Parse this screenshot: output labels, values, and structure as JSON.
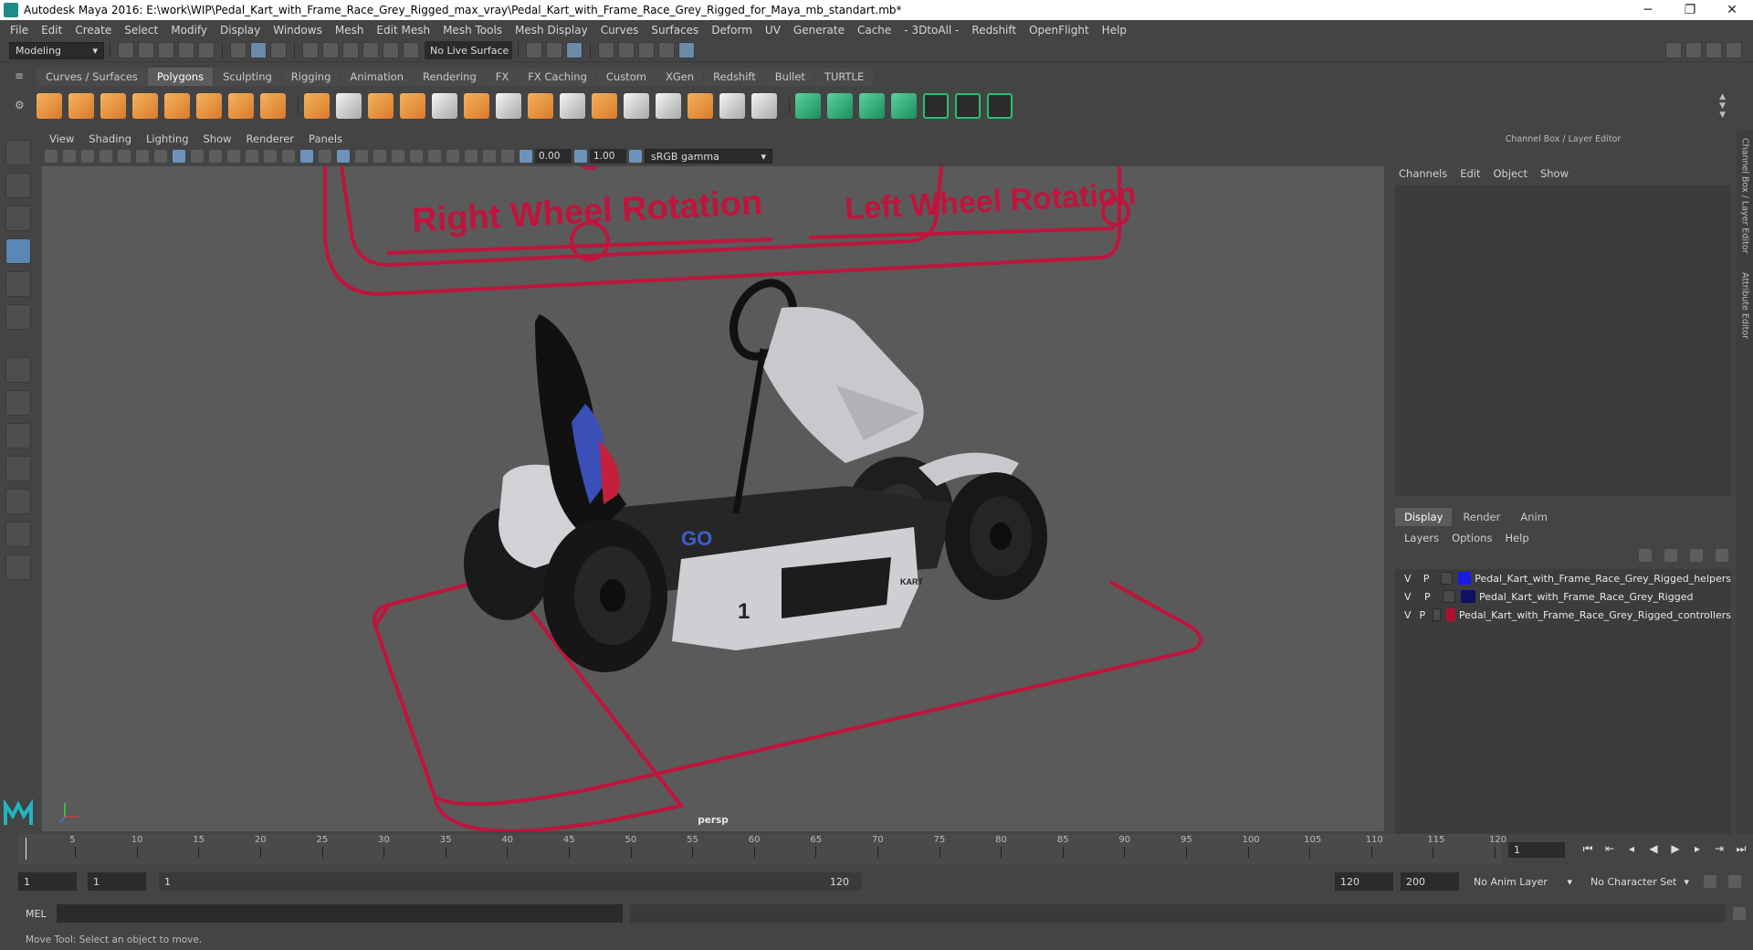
{
  "window": {
    "title": "Autodesk Maya 2016: E:\\work\\WIP\\Pedal_Kart_with_Frame_Race_Grey_Rigged_max_vray\\Pedal_Kart_with_Frame_Race_Grey_Rigged_for_Maya_mb_standart.mb*",
    "min_glyph": "─",
    "max_glyph": "❐",
    "close_glyph": "✕"
  },
  "menubar": [
    "File",
    "Edit",
    "Create",
    "Select",
    "Modify",
    "Display",
    "Windows",
    "Mesh",
    "Edit Mesh",
    "Mesh Tools",
    "Mesh Display",
    "Curves",
    "Surfaces",
    "Deform",
    "UV",
    "Generate",
    "Cache",
    "- 3DtoAll -",
    "Redshift",
    "OpenFlight",
    "Help"
  ],
  "statusline": {
    "mode": "Modeling",
    "live_surface": "No Live Surface"
  },
  "shelf": {
    "tabs": [
      "Curves / Surfaces",
      "Polygons",
      "Sculpting",
      "Rigging",
      "Animation",
      "Rendering",
      "FX",
      "FX Caching",
      "Custom",
      "XGen",
      "Redshift",
      "Bullet",
      "TURTLE"
    ],
    "active_tab": 1
  },
  "viewport": {
    "menu": [
      "View",
      "Shading",
      "Lighting",
      "Show",
      "Renderer",
      "Panels"
    ],
    "field_a": "0.00",
    "field_b": "1.00",
    "color_space": "sRGB gamma",
    "camera": "persp",
    "labels": {
      "right": "Right Wheel Rotation",
      "left": "Left Wheel Rotation",
      "go": "GO",
      "number": "1",
      "kart": "KART"
    },
    "colors": {
      "controller": "#c0143c",
      "kart_body": "#c9c9cd",
      "background": "#5a5a5a"
    }
  },
  "right_panel": {
    "title": "Channel Box / Layer Editor",
    "cb_menu": [
      "Channels",
      "Edit",
      "Object",
      "Show"
    ],
    "le_tabs": [
      "Display",
      "Render",
      "Anim"
    ],
    "le_active": 0,
    "le_menu": [
      "Layers",
      "Options",
      "Help"
    ],
    "layers": [
      {
        "v": "V",
        "p": "P",
        "color": "#1a1ae6",
        "name": "Pedal_Kart_with_Frame_Race_Grey_Rigged_helpers"
      },
      {
        "v": "V",
        "p": "P",
        "color": "#101060",
        "name": "Pedal_Kart_with_Frame_Race_Grey_Rigged"
      },
      {
        "v": "V",
        "p": "P",
        "color": "#b01030",
        "name": "Pedal_Kart_with_Frame_Race_Grey_Rigged_controllers"
      }
    ],
    "side_tabs": [
      "Channel Box / Layer Editor",
      "Attribute Editor"
    ]
  },
  "timeline": {
    "start": 1,
    "end": 120,
    "current_frame": "1",
    "labels": [
      "5",
      "10",
      "15",
      "20",
      "25",
      "30",
      "35",
      "40",
      "45",
      "50",
      "55",
      "60",
      "65",
      "70",
      "75",
      "80",
      "85",
      "90",
      "95",
      "100",
      "105",
      "110",
      "115",
      "120"
    ]
  },
  "range": {
    "start": "1",
    "playback_start": "1",
    "slider_start": "1",
    "slider_end": "120",
    "playback_end": "120",
    "end": "200",
    "anim_layer": "No Anim Layer",
    "character_set": "No Character Set"
  },
  "command": {
    "label": "MEL",
    "value": ""
  },
  "help": "Move Tool: Select an object to move."
}
